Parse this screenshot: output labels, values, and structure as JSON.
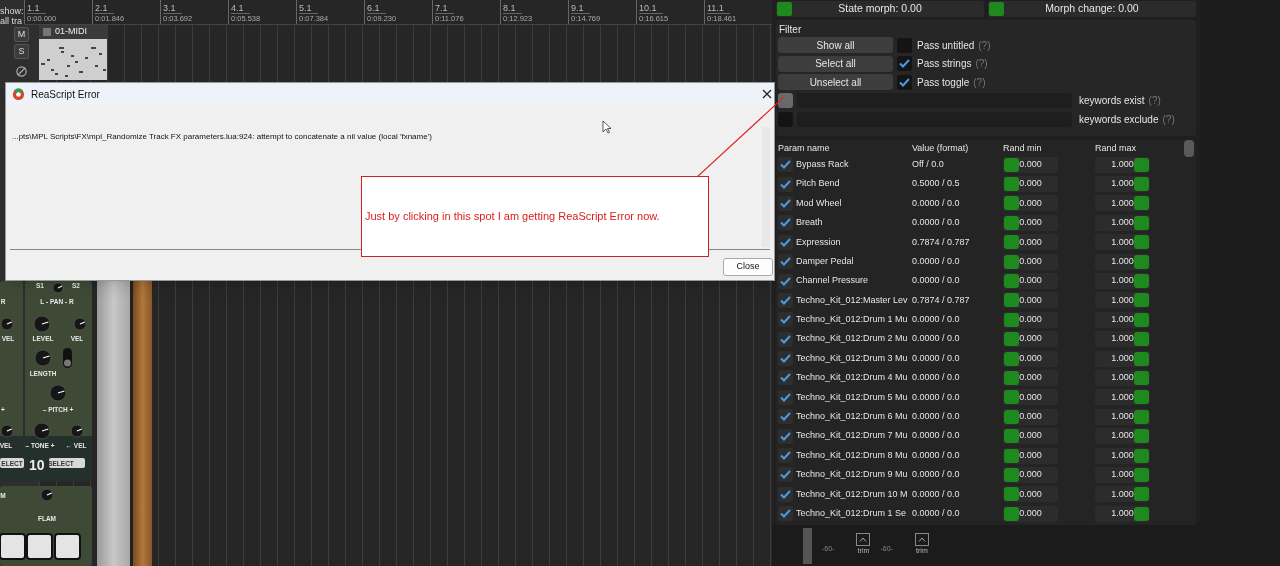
{
  "daw": {
    "track_filter": [
      "show:",
      "all tra"
    ],
    "track_buttons": [
      "M",
      "S"
    ],
    "ruler": [
      {
        "bar": "1.1",
        "time": "0:00.000"
      },
      {
        "bar": "2.1",
        "time": "0:01.846"
      },
      {
        "bar": "3.1",
        "time": "0:03.692"
      },
      {
        "bar": "4.1",
        "time": "0:05.538"
      },
      {
        "bar": "5.1",
        "time": "0:07.384"
      },
      {
        "bar": "6.1",
        "time": "0:09.230"
      },
      {
        "bar": "7.1",
        "time": "0:11.076"
      },
      {
        "bar": "8.1",
        "time": "0:12.923"
      },
      {
        "bar": "9.1",
        "time": "0:14.769"
      },
      {
        "bar": "10.1",
        "time": "0:16.615"
      },
      {
        "bar": "11.1",
        "time": "0:18.461"
      }
    ],
    "midi_item": {
      "name": "01-MIDI"
    }
  },
  "instrument": {
    "labels": [
      "S1",
      "S2",
      "R",
      "L - PAN - R",
      "VEL",
      "LEVEL",
      "VEL",
      "LENGTH",
      "+",
      "– PITCH +",
      "VEL",
      "– TONE +",
      "← VEL",
      "M",
      "FLAM"
    ],
    "number": "10",
    "select_buttons": [
      "ELECT",
      "SELECT"
    ]
  },
  "dialog": {
    "title": "ReaScript Error",
    "message": "...pts\\MPL Scripts\\FX\\mpl_Randomize Track FX parameters.lua:924: attempt to concatenate a nil value (local 'fxname')",
    "button": "Close"
  },
  "annotation": {
    "text": "Just by clicking in this spot I am getting ReaScript Error now."
  },
  "randomizer": {
    "morph": [
      {
        "label": "State morph: 0.00",
        "on": true
      },
      {
        "label": "Morph change: 0.00",
        "on": true
      }
    ],
    "filter": {
      "title": "Filter",
      "buttons": [
        "Show all",
        "Select all",
        "Unselect all"
      ],
      "options": [
        {
          "label": "Pass untitled",
          "hint": "(?)",
          "checked": false
        },
        {
          "label": "Pass strings",
          "hint": "(?)",
          "checked": true
        },
        {
          "label": "Pass toggle",
          "hint": "(?)",
          "checked": true
        }
      ],
      "keywords": [
        {
          "label": "keywords exist",
          "hint": "(?)",
          "hovered": true
        },
        {
          "label": "keywords exclude",
          "hint": "(?)",
          "hovered": false
        }
      ]
    },
    "table": {
      "columns": [
        "Param name",
        "Value (format)",
        "Rand min",
        "Rand max"
      ],
      "rows": [
        {
          "checked": true,
          "name": "Bypass Rack",
          "value": "Off / 0.0",
          "rand_min": {
            "value": "0.000",
            "level": 0
          },
          "rand_max": {
            "value": "1.000",
            "level": 1
          }
        },
        {
          "checked": true,
          "name": "Pitch Bend",
          "value": "0.5000 / 0.5",
          "rand_min": {
            "value": "0.000",
            "level": 0
          },
          "rand_max": {
            "value": "1.000",
            "level": 1
          }
        },
        {
          "checked": true,
          "name": "Mod Wheel",
          "value": "0.0000 / 0.0",
          "rand_min": {
            "value": "0.000",
            "level": 0
          },
          "rand_max": {
            "value": "1.000",
            "level": 1
          }
        },
        {
          "checked": true,
          "name": "Breath",
          "value": "0.0000 / 0.0",
          "rand_min": {
            "value": "0.000",
            "level": 0
          },
          "rand_max": {
            "value": "1.000",
            "level": 1
          }
        },
        {
          "checked": true,
          "name": "Expression",
          "value": "0.7874 / 0.787",
          "rand_min": {
            "value": "0.000",
            "level": 0
          },
          "rand_max": {
            "value": "1.000",
            "level": 1
          }
        },
        {
          "checked": true,
          "name": "Damper Pedal",
          "value": "0.0000 / 0.0",
          "rand_min": {
            "value": "0.000",
            "level": 0
          },
          "rand_max": {
            "value": "1.000",
            "level": 1
          }
        },
        {
          "checked": true,
          "name": "Channel Pressure",
          "value": "0.0000 / 0.0",
          "rand_min": {
            "value": "0.000",
            "level": 0
          },
          "rand_max": {
            "value": "1.000",
            "level": 1
          }
        },
        {
          "checked": true,
          "name": "Techno_Kit_012:Master Lev",
          "value": "0.7874 / 0.787",
          "rand_min": {
            "value": "0.000",
            "level": 0
          },
          "rand_max": {
            "value": "1.000",
            "level": 1
          }
        },
        {
          "checked": true,
          "name": "Techno_Kit_012:Drum 1 Mu",
          "value": "0.0000 / 0.0",
          "rand_min": {
            "value": "0.000",
            "level": 0
          },
          "rand_max": {
            "value": "1.000",
            "level": 1
          }
        },
        {
          "checked": true,
          "name": "Techno_Kit_012:Drum 2 Mu",
          "value": "0.0000 / 0.0",
          "rand_min": {
            "value": "0.000",
            "level": 0
          },
          "rand_max": {
            "value": "1.000",
            "level": 1
          }
        },
        {
          "checked": true,
          "name": "Techno_Kit_012:Drum 3 Mu",
          "value": "0.0000 / 0.0",
          "rand_min": {
            "value": "0.000",
            "level": 0
          },
          "rand_max": {
            "value": "1.000",
            "level": 1
          }
        },
        {
          "checked": true,
          "name": "Techno_Kit_012:Drum 4 Mu",
          "value": "0.0000 / 0.0",
          "rand_min": {
            "value": "0.000",
            "level": 0
          },
          "rand_max": {
            "value": "1.000",
            "level": 1
          }
        },
        {
          "checked": true,
          "name": "Techno_Kit_012:Drum 5 Mu",
          "value": "0.0000 / 0.0",
          "rand_min": {
            "value": "0.000",
            "level": 0
          },
          "rand_max": {
            "value": "1.000",
            "level": 1
          }
        },
        {
          "checked": true,
          "name": "Techno_Kit_012:Drum 6 Mu",
          "value": "0.0000 / 0.0",
          "rand_min": {
            "value": "0.000",
            "level": 0
          },
          "rand_max": {
            "value": "1.000",
            "level": 1
          }
        },
        {
          "checked": true,
          "name": "Techno_Kit_012:Drum 7 Mu",
          "value": "0.0000 / 0.0",
          "rand_min": {
            "value": "0.000",
            "level": 0
          },
          "rand_max": {
            "value": "1.000",
            "level": 1
          }
        },
        {
          "checked": true,
          "name": "Techno_Kit_012:Drum 8 Mu",
          "value": "0.0000 / 0.0",
          "rand_min": {
            "value": "0.000",
            "level": 0
          },
          "rand_max": {
            "value": "1.000",
            "level": 1
          }
        },
        {
          "checked": true,
          "name": "Techno_Kit_012:Drum 9 Mu",
          "value": "0.0000 / 0.0",
          "rand_min": {
            "value": "0.000",
            "level": 0
          },
          "rand_max": {
            "value": "1.000",
            "level": 1
          }
        },
        {
          "checked": true,
          "name": "Techno_Kit_012:Drum 10 M",
          "value": "0.0000 / 0.0",
          "rand_min": {
            "value": "0.000",
            "level": 0
          },
          "rand_max": {
            "value": "1.000",
            "level": 1
          }
        },
        {
          "checked": true,
          "name": "Techno_Kit_012:Drum 1 Se",
          "value": "0.0000 / 0.0",
          "rand_min": {
            "value": "0.000",
            "level": 0
          },
          "rand_max": {
            "value": "1.000",
            "level": 1
          }
        }
      ]
    }
  },
  "mixer": {
    "scale": [
      "-60-",
      "-60-"
    ],
    "trim": [
      "trim",
      "trim"
    ]
  }
}
